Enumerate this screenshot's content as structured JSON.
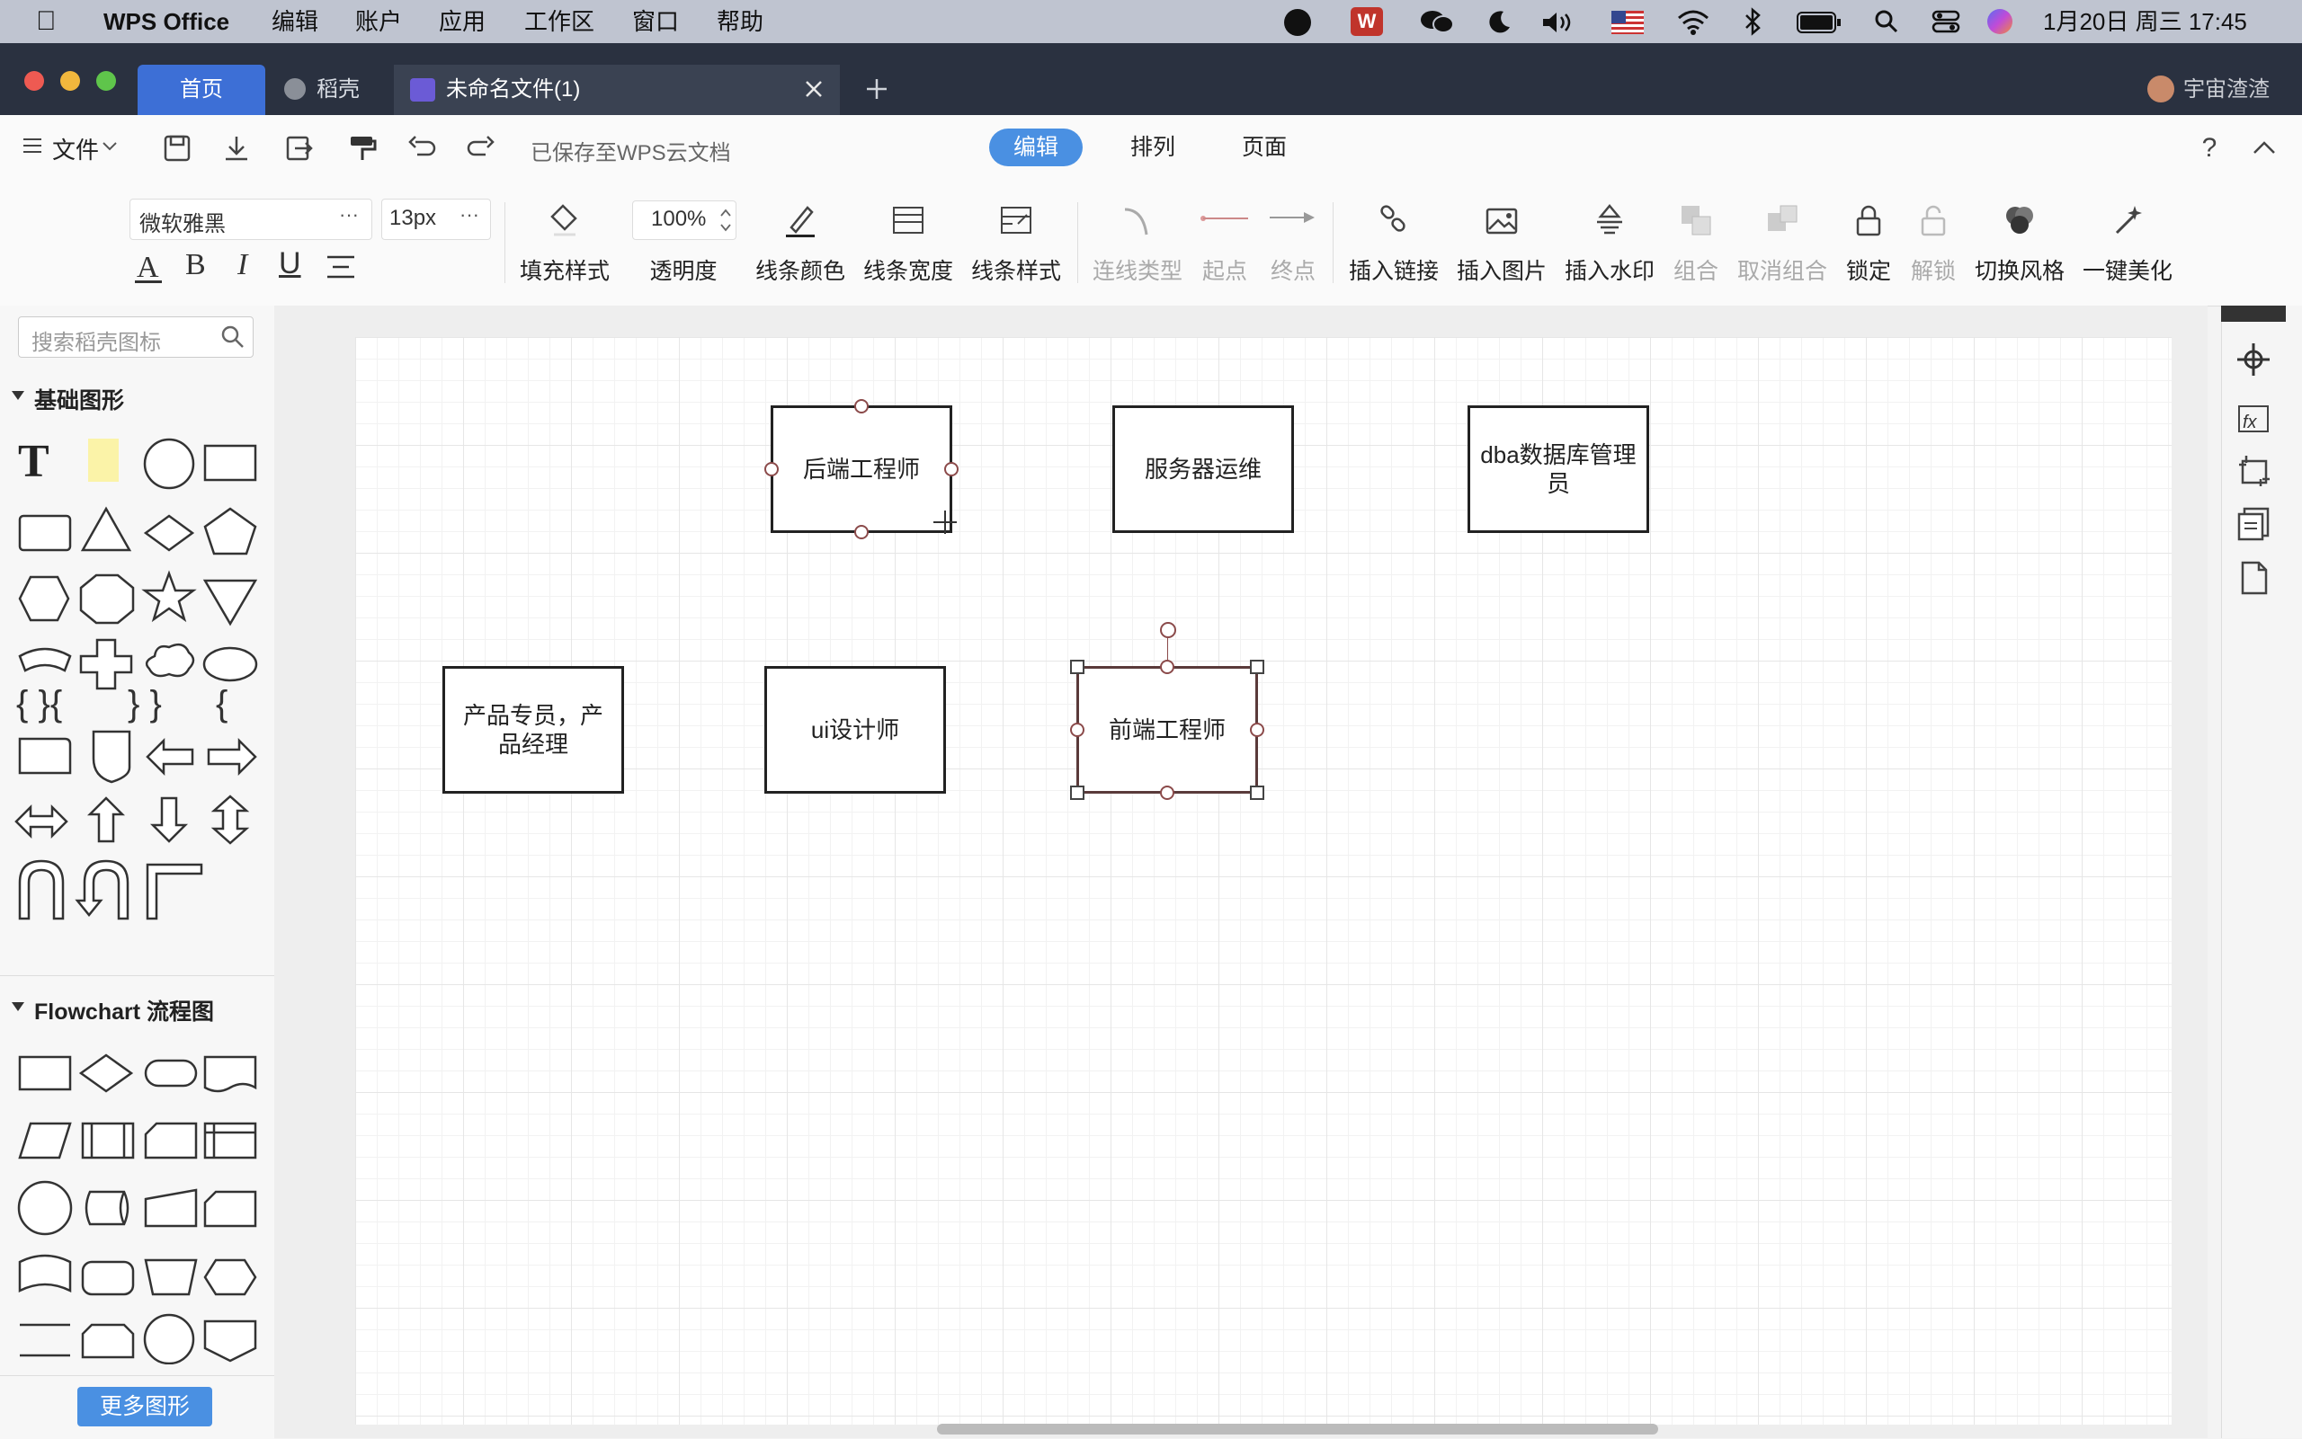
{
  "menubar": {
    "app": "WPS Office",
    "menus": [
      "编辑",
      "账户",
      "应用",
      "工作区",
      "窗口",
      "帮助"
    ],
    "datetime": "1月20日 周三  17:45"
  },
  "tabs": {
    "home": "首页",
    "docer": "稻壳",
    "file": "未命名文件(1)",
    "user": "宇宙渣渣"
  },
  "toolbar": {
    "file_menu": "文件",
    "saved_status": "已保存至WPS云文档",
    "mode_tabs": [
      "编辑",
      "排列",
      "页面"
    ],
    "font_name": "微软雅黑",
    "font_size": "13px",
    "opacity": "100%",
    "buttons": {
      "fill": "填充样式",
      "opacity": "透明度",
      "line_color": "线条颜色",
      "line_width": "线条宽度",
      "line_style": "线条样式",
      "conn_type": "连线类型",
      "start": "起点",
      "end": "终点",
      "insert_link": "插入链接",
      "insert_image": "插入图片",
      "insert_watermark": "插入水印",
      "group": "组合",
      "ungroup": "取消组合",
      "lock": "锁定",
      "unlock": "解锁",
      "switch_style": "切换风格",
      "beautify": "一键美化"
    },
    "format": {
      "bold": "B",
      "italic": "I",
      "underline": "U"
    }
  },
  "sidebar": {
    "search_placeholder": "搜索稻壳图标",
    "section_basic": "基础图形",
    "section_flowchart": "Flowchart 流程图",
    "more_shapes": "更多图形"
  },
  "diagram": {
    "nodes": [
      {
        "id": "backend",
        "label": "后端工程师"
      },
      {
        "id": "ops",
        "label": "服务器运维"
      },
      {
        "id": "dba",
        "label": "dba数据库管理员"
      },
      {
        "id": "product",
        "label": "产品专员，产品经理"
      },
      {
        "id": "ui",
        "label": "ui设计师"
      },
      {
        "id": "frontend",
        "label": "前端工程师"
      }
    ],
    "selected": "前端工程师"
  },
  "colors": {
    "accent": "#4a90e2",
    "menubar": "#bfc4d0",
    "titlebar": "#2a3140",
    "active_tab": "#3d6fd6"
  }
}
